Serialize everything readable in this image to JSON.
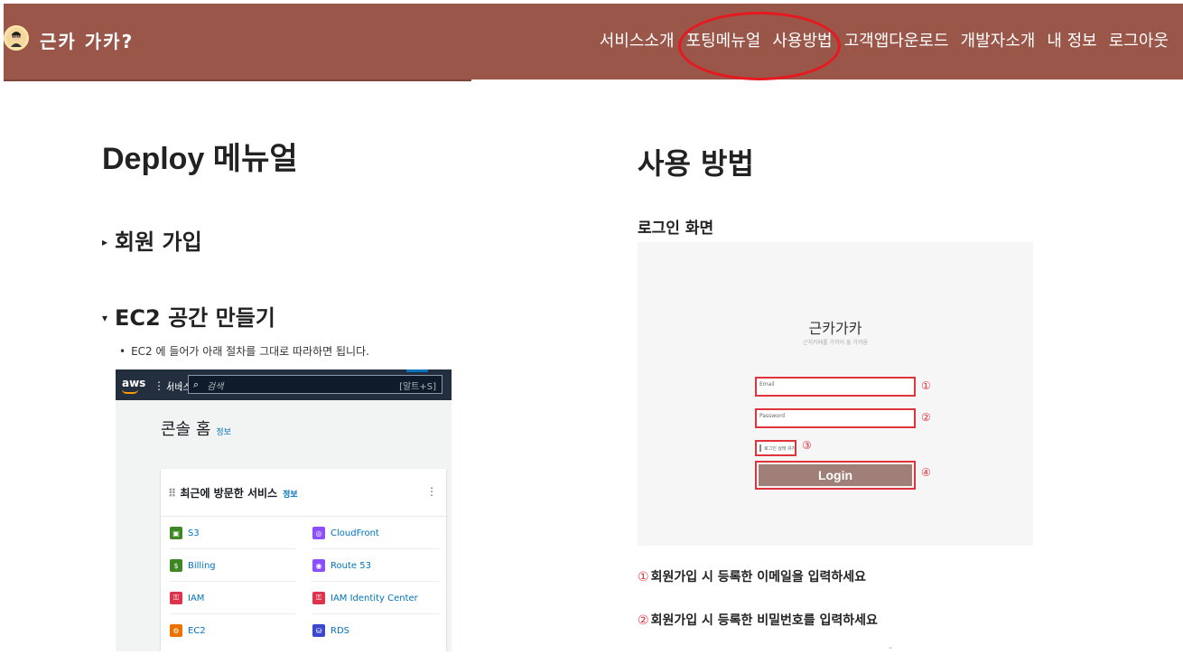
{
  "header": {
    "brand": "근카 가카?",
    "nav": [
      "서비스소개",
      "포팅메뉴얼",
      "사용방법",
      "고객앱다운로드",
      "개발자소개",
      "내 정보",
      "로그아웃"
    ],
    "highlight_color": "#e8181f",
    "bar_color": "#995649"
  },
  "left": {
    "title": "Deploy 메뉴얼",
    "section1": "회원 가입",
    "section2": "EC2 공간 만들기",
    "bullet": "EC2 에 들어가 아래 절차를 그대로 따라하면 됩니다.",
    "aws": {
      "logo": "aws",
      "services_label": "서비스",
      "search_placeholder": "검색",
      "search_shortcut": "[알트+S]",
      "console_title": "콘솔 홈",
      "info": "정보",
      "recent_title": "최근에 방문한 서비스",
      "services": [
        {
          "name": "S3",
          "color": "#3f8624"
        },
        {
          "name": "CloudFront",
          "color": "#8c4fff"
        },
        {
          "name": "Billing",
          "color": "#3f8624"
        },
        {
          "name": "Route 53",
          "color": "#8c4fff"
        },
        {
          "name": "IAM",
          "color": "#dd344c"
        },
        {
          "name": "IAM Identity Center",
          "color": "#dd344c"
        },
        {
          "name": "EC2",
          "color": "#ed7100"
        },
        {
          "name": "RDS",
          "color": "#3b48cc"
        }
      ]
    }
  },
  "right": {
    "title": "사용 방법",
    "login_label": "로그인 화면",
    "shot": {
      "brand": "근카가카",
      "sub": "근처카페를 가까이 둘 가까움",
      "email": "Email",
      "password": "Password",
      "remember": "로그인 상태 유지",
      "login": "Login",
      "nums": [
        "①",
        "②",
        "③",
        "④"
      ]
    },
    "steps": [
      {
        "num": "①",
        "text": "회원가입 시 등록한 이메일을 입력하세요"
      },
      {
        "num": "②",
        "text": "회원가입 시 등록한 비밀번호를 입력하세요"
      }
    ]
  }
}
